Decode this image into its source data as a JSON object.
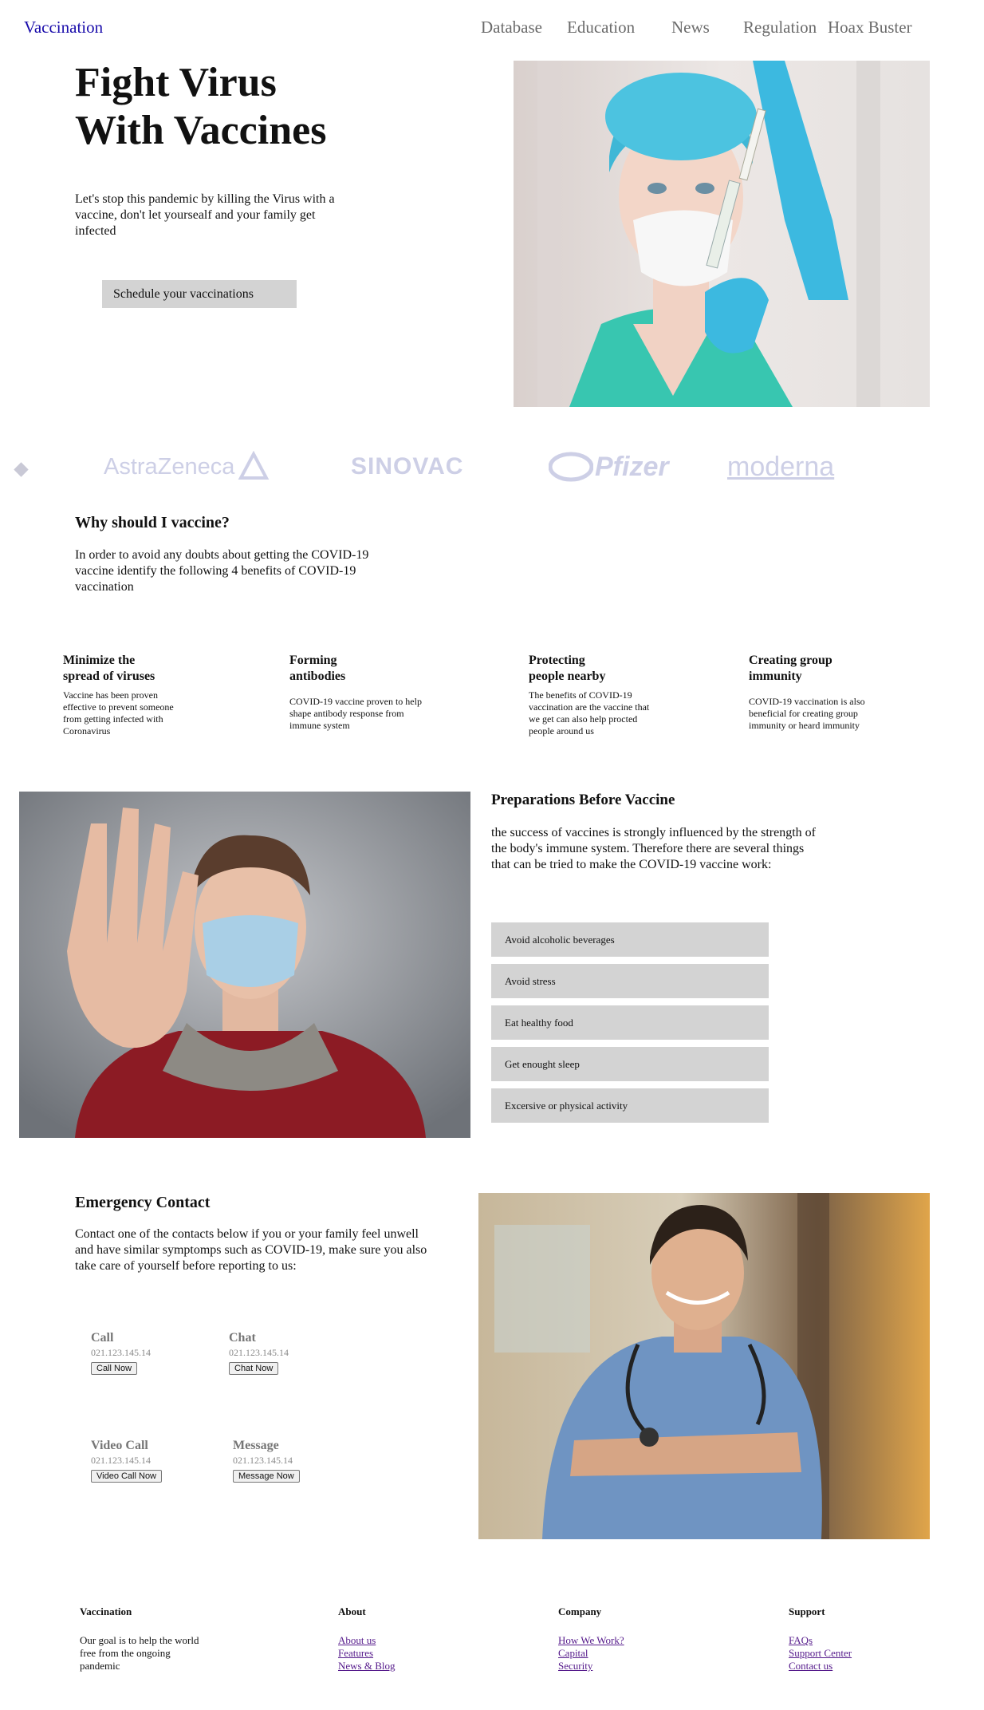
{
  "nav": {
    "brand": "Vaccination",
    "items": [
      "Database",
      "Education",
      "News",
      "Regulation",
      "Hoax Buster"
    ]
  },
  "hero": {
    "title_line1": "Fight Virus",
    "title_line2": "With Vaccines",
    "description": "Let's stop this pandemic by killing the Virus with a vaccine, don't let yoursealf and your family get infected",
    "button": "Schedule your vaccinations"
  },
  "logos": [
    "AstraZeneca",
    "SINOVAC",
    "Pfizer",
    "moderna"
  ],
  "why": {
    "title": "Why should I vaccine?",
    "description": "In order to avoid any doubts about getting the COVID-19 vaccine identify the following 4 benefits of COVID-19 vaccination"
  },
  "benefits": [
    {
      "title_line1": "Minimize the",
      "title_line2": "spread of viruses",
      "text": "Vaccine has been proven effective to prevent someone from getting infected with Coronavirus"
    },
    {
      "title_line1": "Forming",
      "title_line2": "antibodies",
      "text": "COVID-19 vaccine proven to help shape antibody response from immune system"
    },
    {
      "title_line1": "Protecting",
      "title_line2": "people nearby",
      "text": "The benefits of COVID-19 vaccination are the vaccine that we get can also help procted people around us"
    },
    {
      "title_line1": "Creating group",
      "title_line2": "immunity",
      "text": "COVID-19 vaccination is also beneficial for creating group immunity or heard immunity"
    }
  ],
  "preparations": {
    "title": "Preparations Before Vaccine",
    "description": "the success of vaccines is strongly influenced by the strength of the body's immune system. Therefore there are several things that can be tried to make the COVID-19 vaccine work:",
    "items": [
      "Avoid alcoholic beverages",
      "Avoid stress",
      "Eat healthy food",
      "Get enought sleep",
      "Excersive or physical activity"
    ]
  },
  "emergency": {
    "title": "Emergency Contact",
    "description": "Contact one of the contacts below if you or your family feel unwell and have similar symptomps such as COVID-19, make sure you also take care of yourself before reporting to us:",
    "contacts": [
      {
        "title": "Call",
        "phone": "021.123.145.14",
        "button": "Call Now"
      },
      {
        "title": "Chat",
        "phone": "021.123.145.14",
        "button": "Chat Now"
      },
      {
        "title": "Video Call",
        "phone": "021.123.145.14",
        "button": "Video Call Now"
      },
      {
        "title": "Message",
        "phone": "021.123.145.14",
        "button": "Message Now"
      }
    ]
  },
  "footer": {
    "brand_title": "Vaccination",
    "brand_text": "Our goal is to help the world free from the ongoing pandemic",
    "about_title": "About",
    "about_links": [
      "About us",
      "Features",
      "News & Blog"
    ],
    "company_title": "Company",
    "company_links": [
      "How We Work?",
      "Capital",
      "Security"
    ],
    "support_title": "Support",
    "support_links": [
      "FAQs",
      "Support Center",
      "Contact us"
    ]
  }
}
